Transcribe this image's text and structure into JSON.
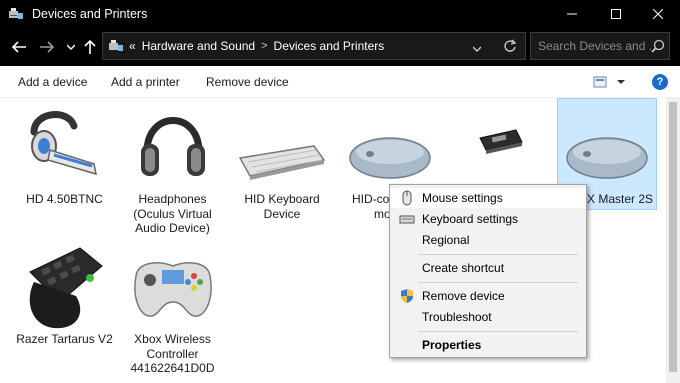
{
  "window": {
    "title": "Devices and Printers"
  },
  "address": {
    "overflow": "«",
    "crumbs": [
      "Hardware and Sound",
      "Devices and Printers"
    ],
    "search_placeholder": "Search Devices and ..."
  },
  "toolbar": {
    "add_device": "Add a device",
    "add_printer": "Add a printer",
    "remove_device": "Remove device",
    "help": "?"
  },
  "devices": [
    {
      "label": "HD 4.50BTNC",
      "icon": "headset-icon"
    },
    {
      "label": "Headphones (Oculus Virtual Audio Device)",
      "icon": "headphones-icon"
    },
    {
      "label": "HID Keyboard Device",
      "icon": "keyboard-icon"
    },
    {
      "label": "HID-co... mo...",
      "icon": "mouse-icon"
    },
    {
      "label": "",
      "icon": "usb-receiver-icon"
    },
    {
      "label": "MX Master 2S",
      "icon": "mouse-icon"
    },
    {
      "label": "Razer Tartarus V2",
      "icon": "keypad-icon"
    },
    {
      "label": "Xbox Wireless Controller 441622641D0D",
      "icon": "gamepad-icon"
    }
  ],
  "device_lines": {
    "d0": [
      "HD 4.50BTNC"
    ],
    "d1": [
      "Headphones",
      "(Oculus Virtual",
      "Audio Device)"
    ],
    "d2": [
      "HID Keyboard",
      "Device"
    ],
    "d3": [
      "HID-co",
      "mo"
    ],
    "d5": [
      "X Master 2S"
    ],
    "d6": [
      "Razer Tartarus V2"
    ],
    "d7": [
      "Xbox Wireless",
      "Controller",
      "441622641D0D"
    ]
  },
  "context_menu": {
    "mouse_settings": "Mouse settings",
    "keyboard_settings": "Keyboard settings",
    "regional": "Regional",
    "create_shortcut": "Create shortcut",
    "remove_device": "Remove device",
    "troubleshoot": "Troubleshoot",
    "properties": "Properties"
  },
  "colors": {
    "selection": "#cce8ff",
    "help_blue": "#1b6ac9",
    "chrome": "#000000"
  }
}
